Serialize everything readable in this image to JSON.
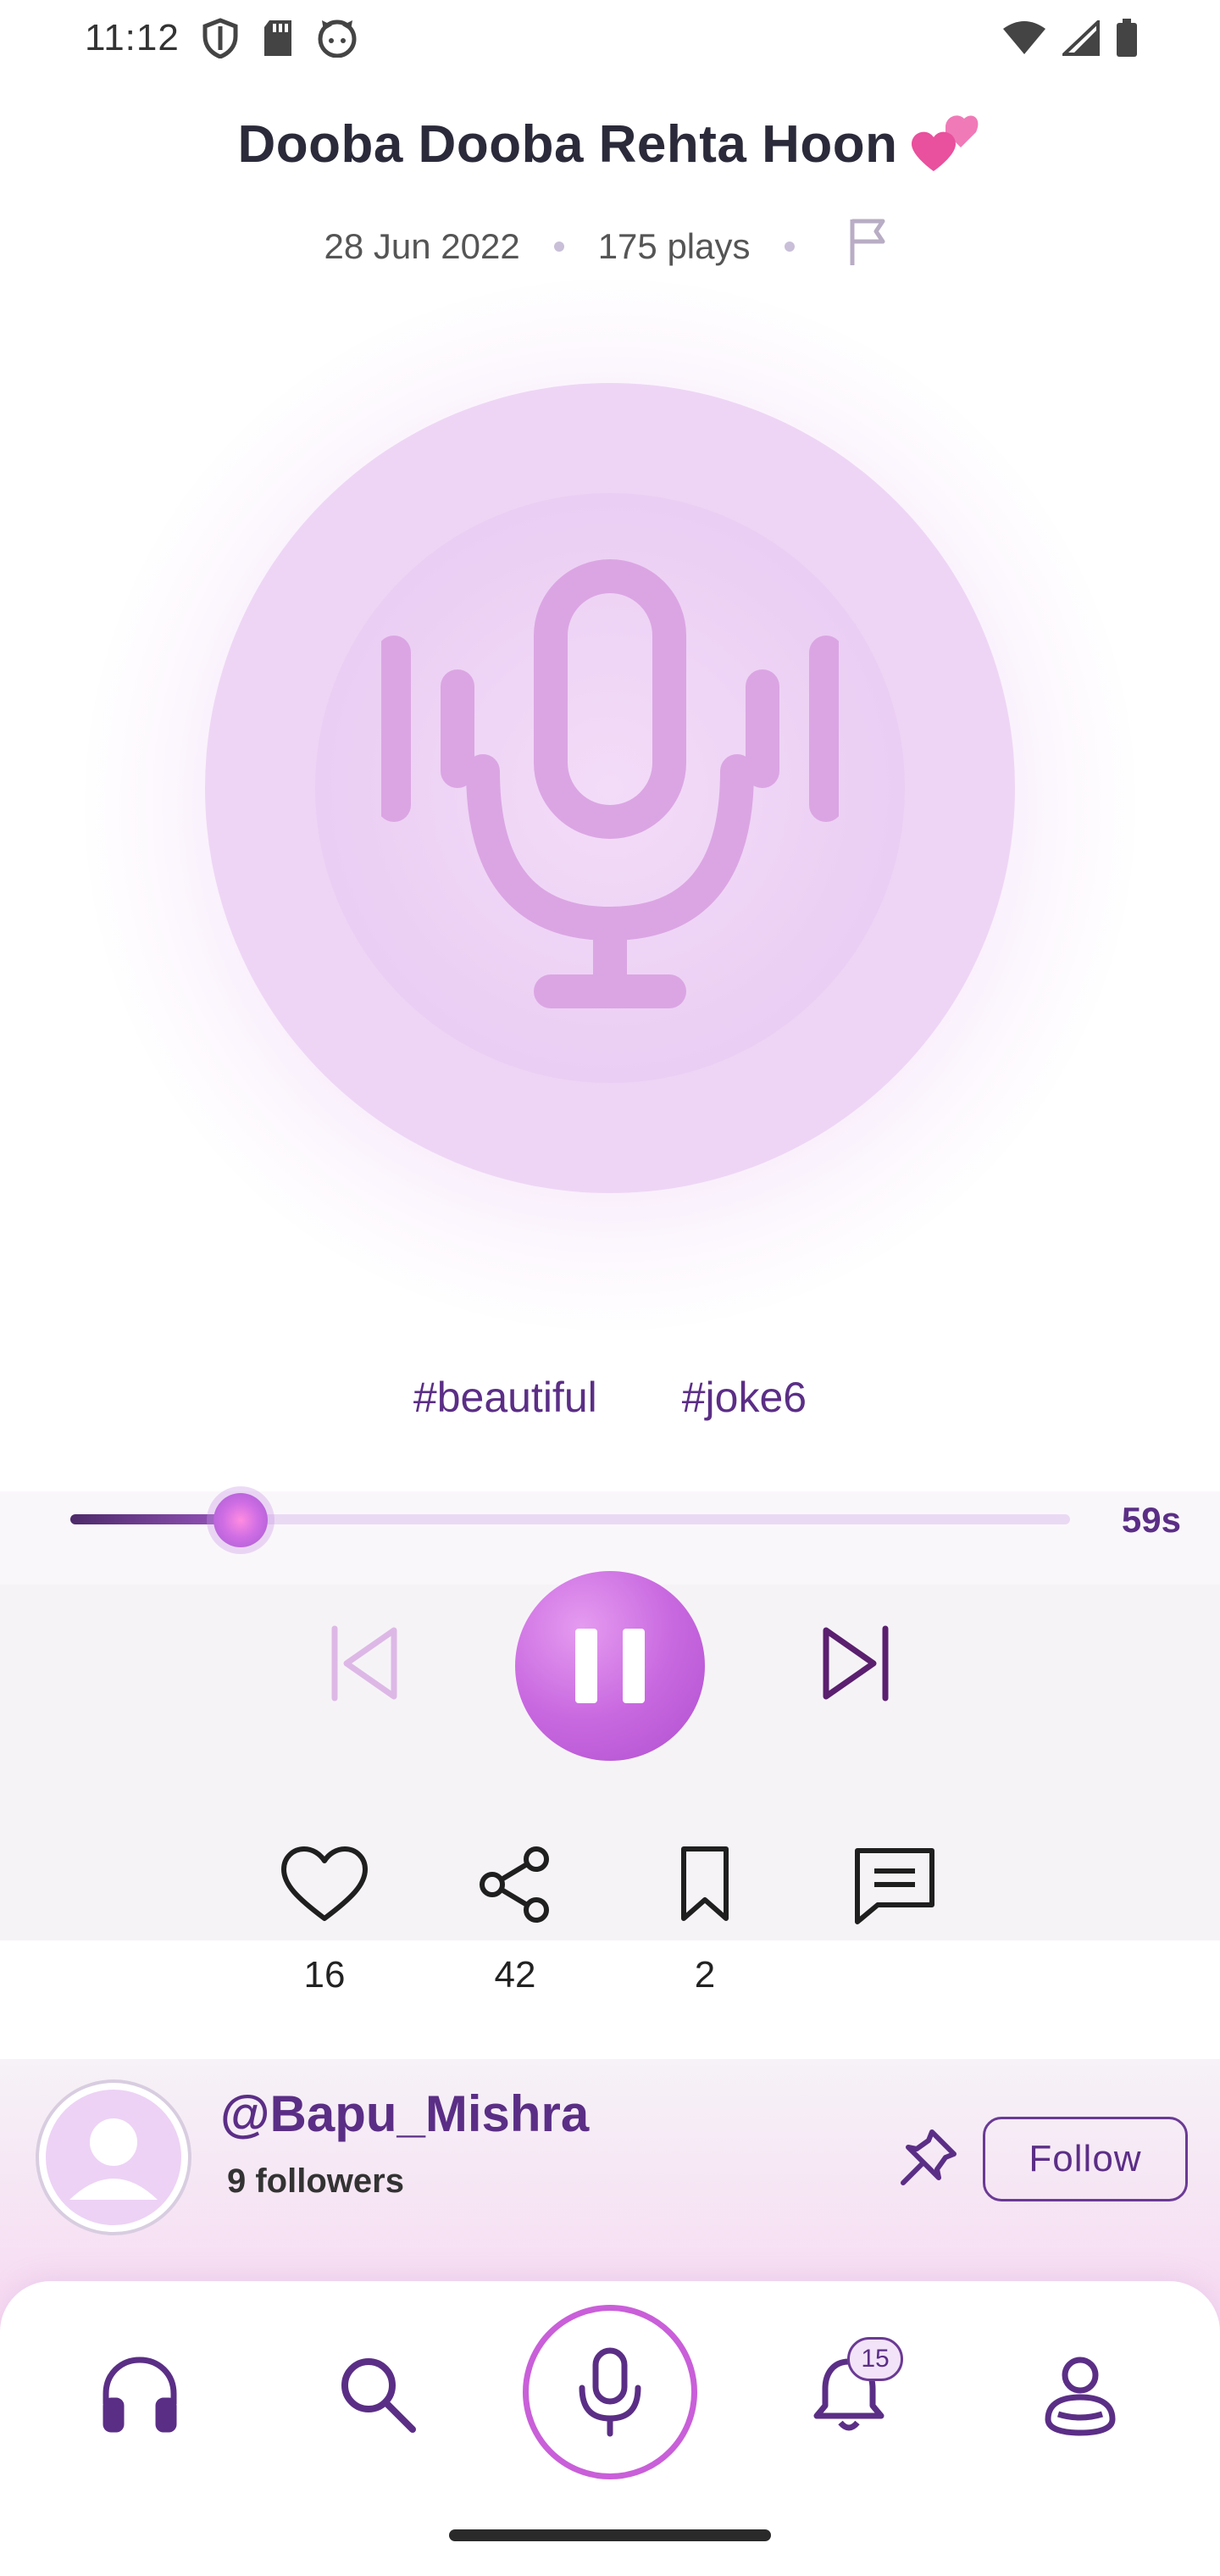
{
  "status_bar": {
    "time": "11:12",
    "icons_left": [
      "shield-icon",
      "sd-card-icon",
      "cat-face-icon"
    ],
    "icons_right": [
      "wifi-icon",
      "cell-signal-icon",
      "battery-icon"
    ]
  },
  "track": {
    "title": "Dooba Dooba Rehta Hoon",
    "title_emoji": "💞",
    "date": "28 Jun 2022",
    "plays": "175 plays",
    "tags": [
      "#beautiful",
      "#joke6"
    ]
  },
  "player": {
    "progress": 0.17,
    "time_remaining": "59s"
  },
  "actions": {
    "likes": "16",
    "shares": "42",
    "saves": "2"
  },
  "author": {
    "handle": "@Bapu_Mishra",
    "followers": "9 followers",
    "follow_label": "Follow"
  },
  "nav": {
    "notifications_badge": "15"
  },
  "colors": {
    "accent": "#5b2e86",
    "play_button": "#c969e0",
    "art_light": "#ecd2f4",
    "mic": "#dba5e3"
  }
}
